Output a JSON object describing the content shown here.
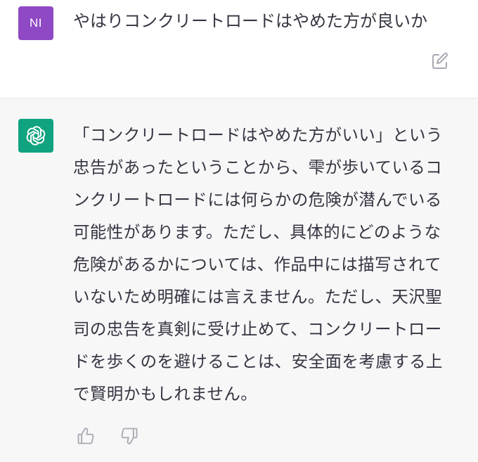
{
  "conversation": {
    "user_message": {
      "avatar_initials": "NI",
      "avatar_color": "#8f49c4",
      "text": "やはりコンクリートロードはやめた方が良いか",
      "edit_icon": "edit-icon"
    },
    "assistant_message": {
      "avatar_icon": "openai-logo-icon",
      "avatar_color": "#10a37f",
      "text": "「コンクリートロードはやめた方がいい」という忠告があったということから、雫が歩いているコンクリートロードには何らかの危険が潜んでいる可能性があります。ただし、具体的にどのような危険があるかについては、作品中には描写されていないため明確には言えません。ただし、天沢聖司の忠告を真剣に受け止めて、コンクリートロードを歩くのを避けることは、安全面を考慮する上で賢明かもしれません。",
      "feedback_icons": [
        "thumbs-up-icon",
        "thumbs-down-icon"
      ]
    }
  }
}
